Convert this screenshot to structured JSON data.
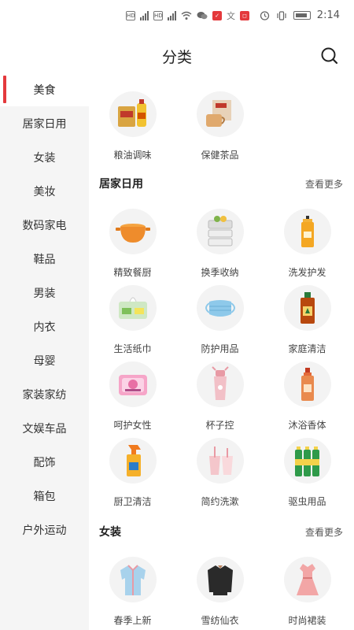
{
  "status_bar": {
    "left_badges": [
      "HD",
      "4G",
      "HD",
      "4G"
    ],
    "time": "2:14",
    "app_icon_text": "文"
  },
  "header": {
    "title": "分类"
  },
  "sidebar": {
    "items": [
      {
        "label": "美食"
      },
      {
        "label": "居家日用"
      },
      {
        "label": "女装"
      },
      {
        "label": "美妆"
      },
      {
        "label": "数码家电"
      },
      {
        "label": "鞋品"
      },
      {
        "label": "男装"
      },
      {
        "label": "内衣"
      },
      {
        "label": "母婴"
      },
      {
        "label": "家装家纺"
      },
      {
        "label": "文娱车品"
      },
      {
        "label": "配饰"
      },
      {
        "label": "箱包"
      },
      {
        "label": "户外运动"
      }
    ]
  },
  "food_items": [
    {
      "label": "粮油调味",
      "icon": "grain-oil-icon"
    },
    {
      "label": "保健茶品",
      "icon": "tea-icon"
    }
  ],
  "sections": [
    {
      "title": "居家日用",
      "more": "查看更多",
      "items": [
        {
          "label": "精致餐厨",
          "icon": "pot-icon"
        },
        {
          "label": "换季收纳",
          "icon": "storage-icon"
        },
        {
          "label": "洗发护发",
          "icon": "shampoo-icon"
        },
        {
          "label": "生活纸巾",
          "icon": "tissue-icon"
        },
        {
          "label": "防护用品",
          "icon": "mask-icon"
        },
        {
          "label": "家庭清洁",
          "icon": "cleaner-bottle-icon"
        },
        {
          "label": "呵护女性",
          "icon": "pad-icon"
        },
        {
          "label": "杯子控",
          "icon": "cup-icon"
        },
        {
          "label": "沐浴香体",
          "icon": "body-wash-icon"
        },
        {
          "label": "厨卫清洁",
          "icon": "spray-icon"
        },
        {
          "label": "简约洗漱",
          "icon": "toothbrush-cup-icon"
        },
        {
          "label": "驱虫用品",
          "icon": "insect-repellent-icon"
        }
      ]
    },
    {
      "title": "女装",
      "more": "查看更多",
      "items": [
        {
          "label": "春季上新",
          "icon": "coat-icon"
        },
        {
          "label": "雪纺仙衣",
          "icon": "blouse-icon"
        },
        {
          "label": "时尚裙装",
          "icon": "dress-icon"
        }
      ]
    }
  ],
  "colors": {
    "accent": "#e4393c",
    "sidebar_bg": "#f5f5f5",
    "thumb_bg": "#f3f3f3"
  }
}
